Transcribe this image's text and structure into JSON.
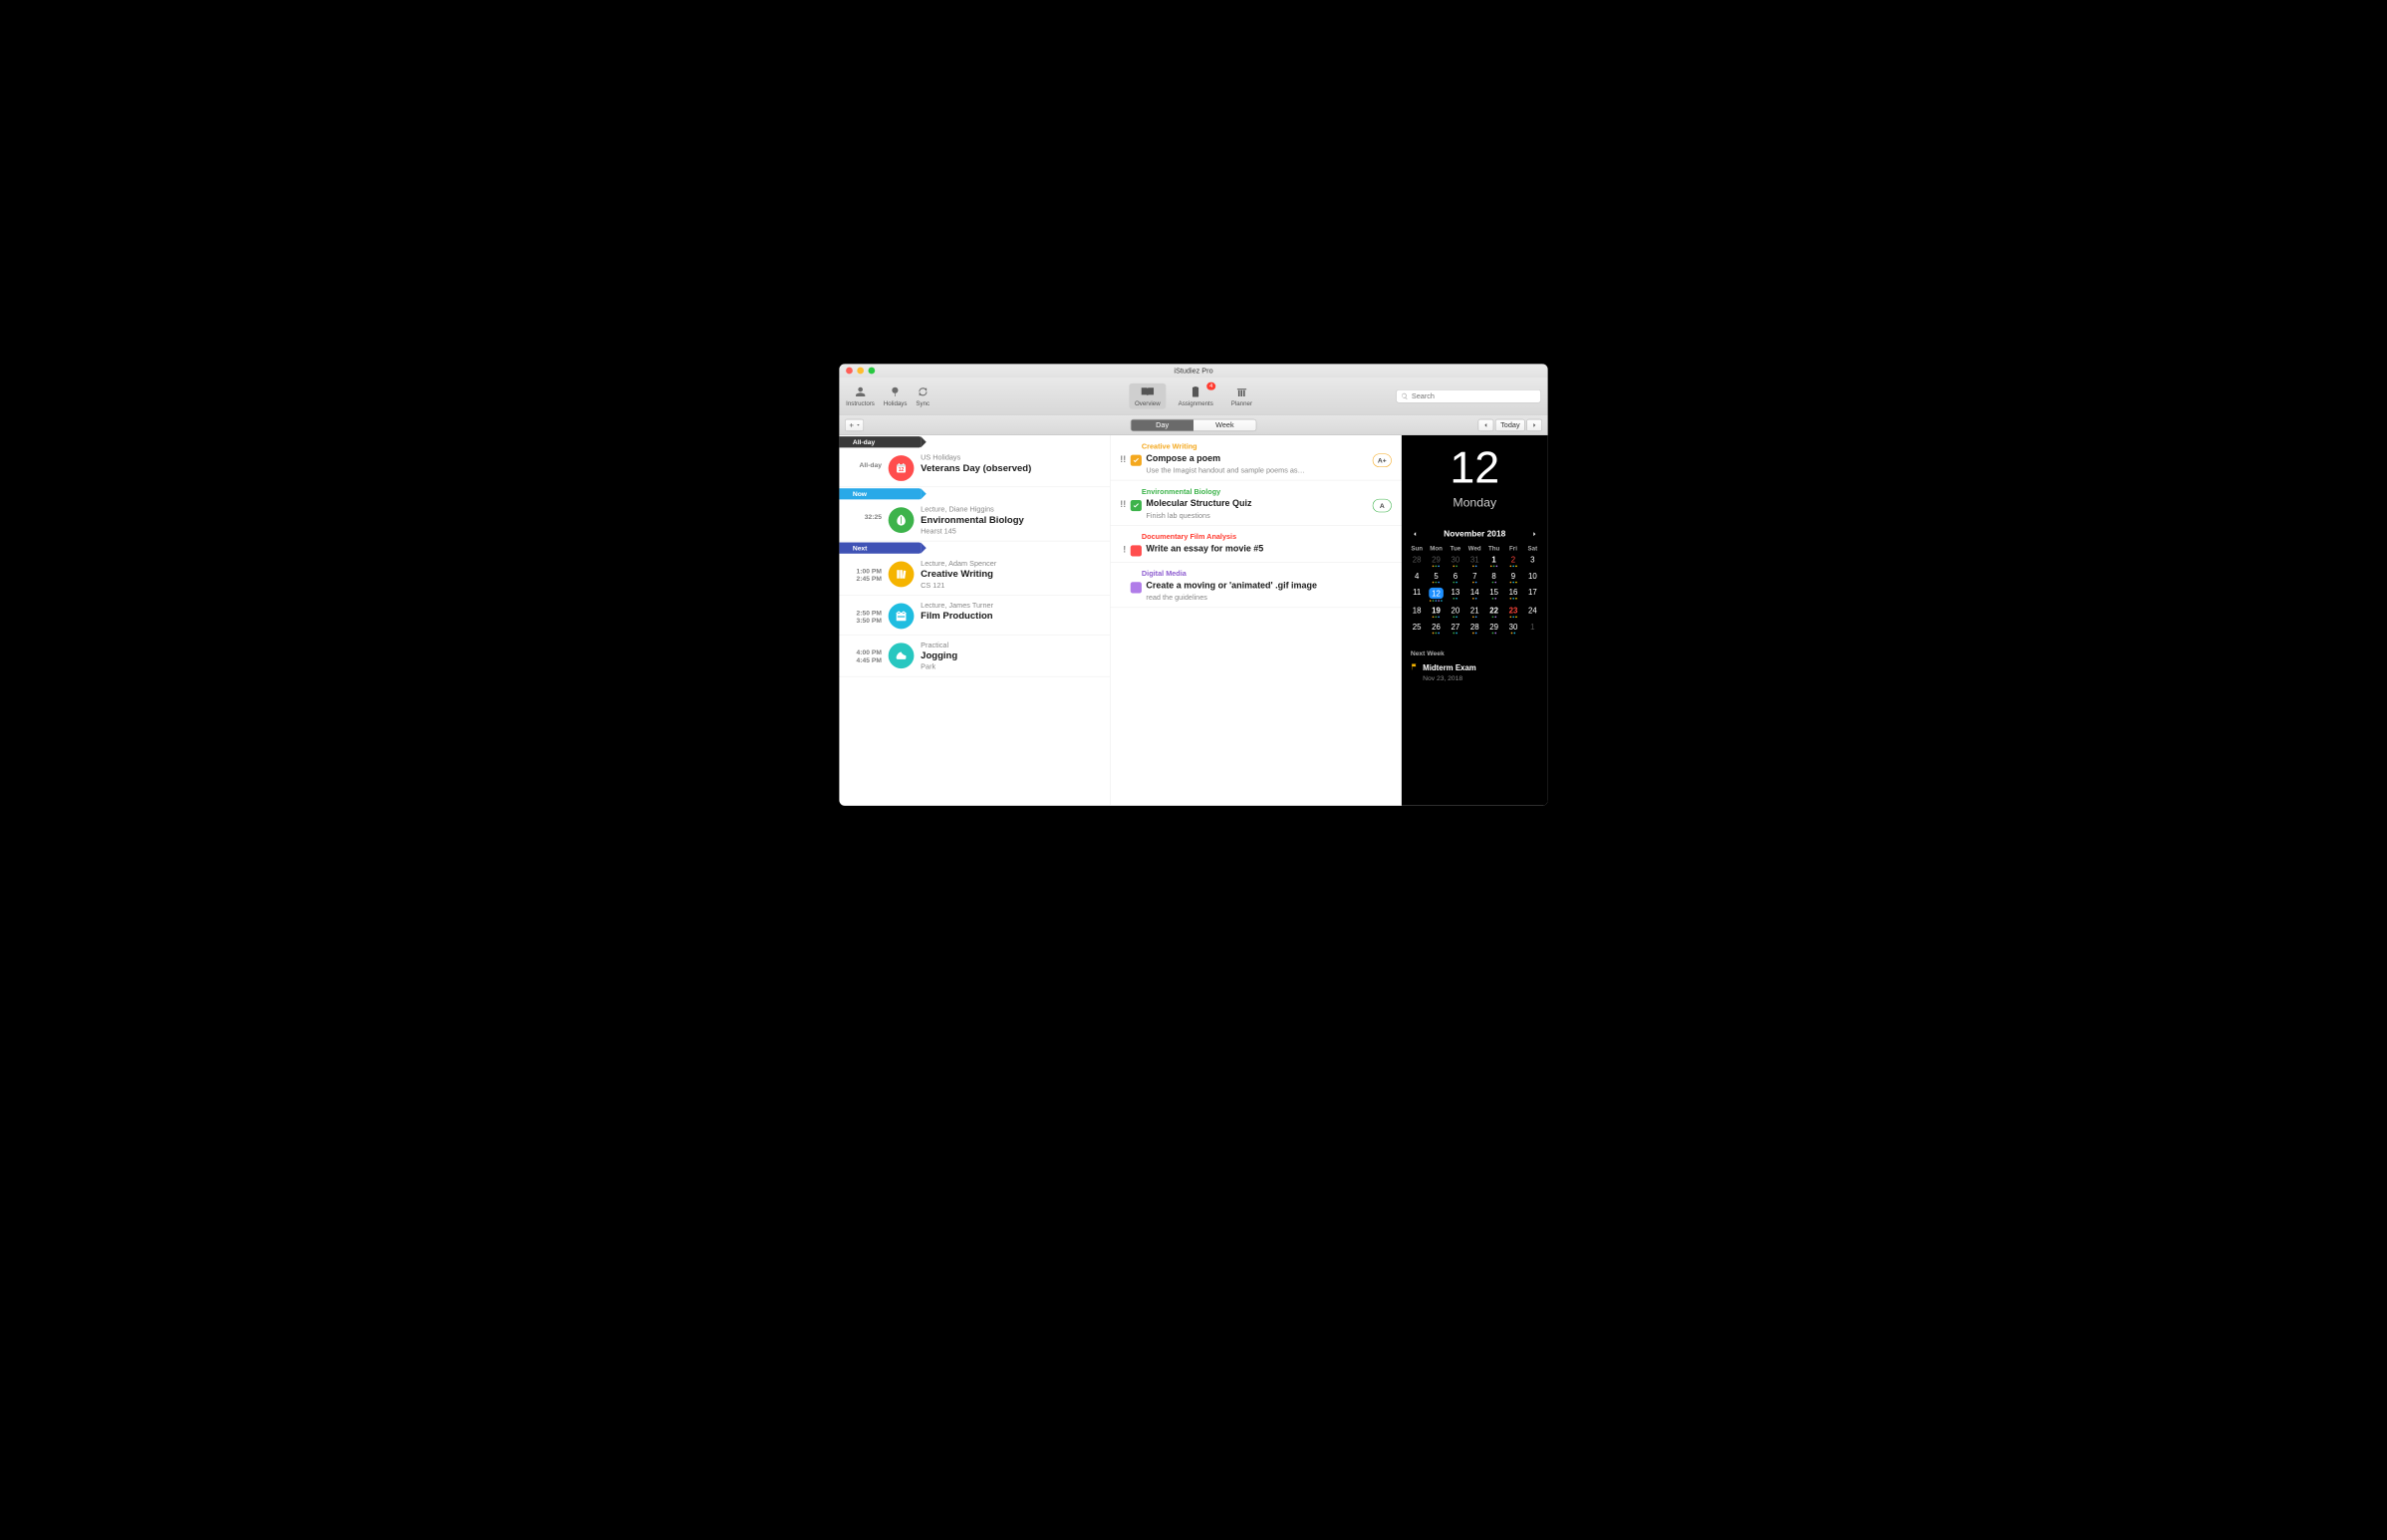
{
  "window": {
    "title": "iStudiez Pro"
  },
  "toolbar": {
    "left": [
      {
        "key": "instructors",
        "label": "Instructors"
      },
      {
        "key": "holidays",
        "label": "Holidays"
      },
      {
        "key": "sync",
        "label": "Sync"
      }
    ],
    "center": [
      {
        "key": "overview",
        "label": "Overview",
        "active": true
      },
      {
        "key": "assignments",
        "label": "Assignments",
        "badge": "4"
      },
      {
        "key": "planner",
        "label": "Planner"
      }
    ],
    "search_ph": "Search"
  },
  "subtoolbar": {
    "seg": [
      {
        "label": "Day",
        "active": true
      },
      {
        "label": "Week",
        "active": false
      }
    ],
    "today": "Today"
  },
  "schedule": {
    "sections": [
      {
        "tag": "All-day",
        "cls": "allday",
        "items": [
          {
            "time1": "All-day",
            "time2": "",
            "iconCls": "ic-red",
            "icon": "cal",
            "meta": "US Holidays",
            "title": "Veterans Day (observed)",
            "sub": ""
          }
        ]
      },
      {
        "tag": "Now",
        "cls": "now",
        "items": [
          {
            "time1": "32:25",
            "time2": "",
            "iconCls": "ic-green",
            "icon": "leaf",
            "meta": "Lecture, Diane Higgins",
            "title": "Environmental Biology",
            "sub": "Hearst 145"
          }
        ]
      },
      {
        "tag": "Next",
        "cls": "next",
        "items": [
          {
            "time1": "1:00 PM",
            "time2": "2:45 PM",
            "iconCls": "ic-yellow",
            "icon": "books",
            "meta": "Lecture, Adam Spencer",
            "title": "Creative Writing",
            "sub": "CS 121"
          },
          {
            "time1": "2:50 PM",
            "time2": "3:50 PM",
            "iconCls": "ic-cyan",
            "icon": "film",
            "meta": "Lecture, James Turner",
            "title": "Film Production",
            "sub": ""
          },
          {
            "time1": "4:00 PM",
            "time2": "4:45 PM",
            "iconCls": "ic-teal",
            "icon": "shoe",
            "meta": "Practical",
            "title": "Jogging",
            "sub": "Park"
          }
        ]
      }
    ]
  },
  "assignments": [
    {
      "course": "Creative Writing",
      "courseCls": "c-orange",
      "priority": "!!",
      "chkCls": "chk-orange",
      "checked": true,
      "title": "Compose a poem",
      "sub": "Use the Imagist handout and sample poems as…",
      "grade": "A+",
      "gradeCls": "g-orange"
    },
    {
      "course": "Environmental Biology",
      "courseCls": "c-green",
      "priority": "!!",
      "chkCls": "chk-green",
      "checked": true,
      "title": "Molecular Structure Quiz",
      "sub": "Finish lab questions",
      "grade": "A",
      "gradeCls": "g-green"
    },
    {
      "course": "Documentary Film Analysis",
      "courseCls": "c-red",
      "priority": "!",
      "chkCls": "chk-red",
      "checked": false,
      "title": "Write an essay for movie #5",
      "sub": "",
      "grade": "",
      "gradeCls": ""
    },
    {
      "course": "Digital Media",
      "courseCls": "c-purple",
      "priority": "",
      "chkCls": "chk-purple",
      "checked": false,
      "title": "Create a moving or 'animated' .gif image",
      "sub": "read the guidelines",
      "grade": "",
      "gradeCls": ""
    }
  ],
  "side": {
    "dayNum": "12",
    "weekday": "Monday",
    "calTitle": "November 2018",
    "dow": [
      "Sun",
      "Mon",
      "Tue",
      "Wed",
      "Thu",
      "Fri",
      "Sat"
    ],
    "weeks": [
      [
        {
          "n": "28",
          "dim": true,
          "dots": []
        },
        {
          "n": "29",
          "dim": true,
          "dots": [
            "o",
            "g",
            "b"
          ]
        },
        {
          "n": "30",
          "dim": true,
          "dots": [
            "o",
            "g"
          ]
        },
        {
          "n": "31",
          "dim": true,
          "dots": [
            "o",
            "b"
          ]
        },
        {
          "n": "1",
          "bold": true,
          "dots": [
            "o",
            "g",
            "p"
          ]
        },
        {
          "n": "2",
          "red": true,
          "dots": [
            "o",
            "c",
            "y"
          ]
        },
        {
          "n": "3",
          "dots": []
        }
      ],
      [
        {
          "n": "4",
          "dots": []
        },
        {
          "n": "5",
          "dots": [
            "o",
            "g",
            "b"
          ]
        },
        {
          "n": "6",
          "dots": [
            "g",
            "c"
          ]
        },
        {
          "n": "7",
          "dots": [
            "o",
            "b"
          ]
        },
        {
          "n": "8",
          "dots": [
            "g",
            "p"
          ]
        },
        {
          "n": "9",
          "dots": [
            "o",
            "c",
            "y"
          ]
        },
        {
          "n": "10",
          "dots": []
        }
      ],
      [
        {
          "n": "11",
          "dots": []
        },
        {
          "n": "12",
          "today": true,
          "dots": [
            "o",
            "g",
            "b",
            "p",
            "c"
          ]
        },
        {
          "n": "13",
          "dots": [
            "g",
            "c"
          ]
        },
        {
          "n": "14",
          "dots": [
            "o",
            "b"
          ]
        },
        {
          "n": "15",
          "dots": [
            "g",
            "p"
          ]
        },
        {
          "n": "16",
          "dots": [
            "o",
            "c",
            "y"
          ]
        },
        {
          "n": "17",
          "dots": []
        }
      ],
      [
        {
          "n": "18",
          "dots": []
        },
        {
          "n": "19",
          "bold": true,
          "dots": [
            "o",
            "g",
            "b"
          ]
        },
        {
          "n": "20",
          "dots": [
            "g",
            "c"
          ]
        },
        {
          "n": "21",
          "dots": [
            "o",
            "b"
          ]
        },
        {
          "n": "22",
          "bold": true,
          "dots": [
            "g",
            "p"
          ]
        },
        {
          "n": "23",
          "red": true,
          "bold": true,
          "dots": [
            "o",
            "c",
            "y"
          ]
        },
        {
          "n": "24",
          "dots": []
        }
      ],
      [
        {
          "n": "25",
          "dots": []
        },
        {
          "n": "26",
          "dots": [
            "o",
            "g",
            "b"
          ]
        },
        {
          "n": "27",
          "dots": [
            "g",
            "c"
          ]
        },
        {
          "n": "28",
          "dots": [
            "o",
            "b"
          ]
        },
        {
          "n": "29",
          "dots": [
            "g",
            "p"
          ]
        },
        {
          "n": "30",
          "dots": [
            "o",
            "c"
          ]
        },
        {
          "n": "1",
          "dim": true,
          "dots": []
        }
      ]
    ],
    "upcoming": {
      "heading": "Next Week",
      "title": "Midterm Exam",
      "date": "Nov 23, 2018"
    }
  }
}
